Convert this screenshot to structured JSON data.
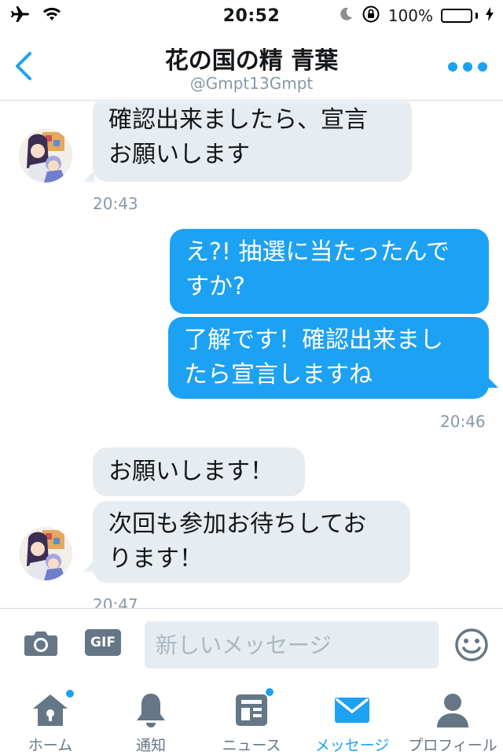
{
  "status_bar": {
    "time": "20:52",
    "battery_percent": "100%",
    "battery_level": 1.0
  },
  "header": {
    "title": "花の国の精 青葉",
    "handle": "@Gmpt13Gmpt"
  },
  "messages": [
    {
      "id": "m1",
      "direction": "in",
      "lines": [
        "確認出来ましたら、宣言",
        "お願いします"
      ]
    },
    {
      "id": "m2",
      "direction": "out",
      "lines": [
        "え?! 抽選に当たったんで",
        "すか?"
      ]
    },
    {
      "id": "m3",
      "direction": "out",
      "lines": [
        "了解です！確認出来まし",
        "たら宣言しますね"
      ]
    },
    {
      "id": "m4",
      "direction": "in",
      "lines": [
        "お願いします！"
      ]
    },
    {
      "id": "m5",
      "direction": "in",
      "lines": [
        "次回も参加お待ちしてお",
        "ります！"
      ]
    }
  ],
  "timestamps": {
    "t1": "20:43",
    "t2": "20:46",
    "t3": "20:47"
  },
  "composer": {
    "gif_label": "GIF",
    "placeholder": "新しいメッセージ"
  },
  "tabs": [
    {
      "label": "ホーム",
      "icon": "home-icon",
      "active": false,
      "badge": true
    },
    {
      "label": "通知",
      "icon": "bell-icon",
      "active": false,
      "badge": false
    },
    {
      "label": "ニュース",
      "icon": "news-icon",
      "active": false,
      "badge": true
    },
    {
      "label": "メッセージ",
      "icon": "envelope-icon",
      "active": true,
      "badge": false
    },
    {
      "label": "プロフィール",
      "icon": "person-icon",
      "active": false,
      "badge": false
    }
  ],
  "colors": {
    "accent": "#1da1f2",
    "incoming_bubble": "#e6ecf0",
    "icon_gray": "#657786",
    "timestamp": "#8899a6",
    "battery": "#4cd964"
  }
}
